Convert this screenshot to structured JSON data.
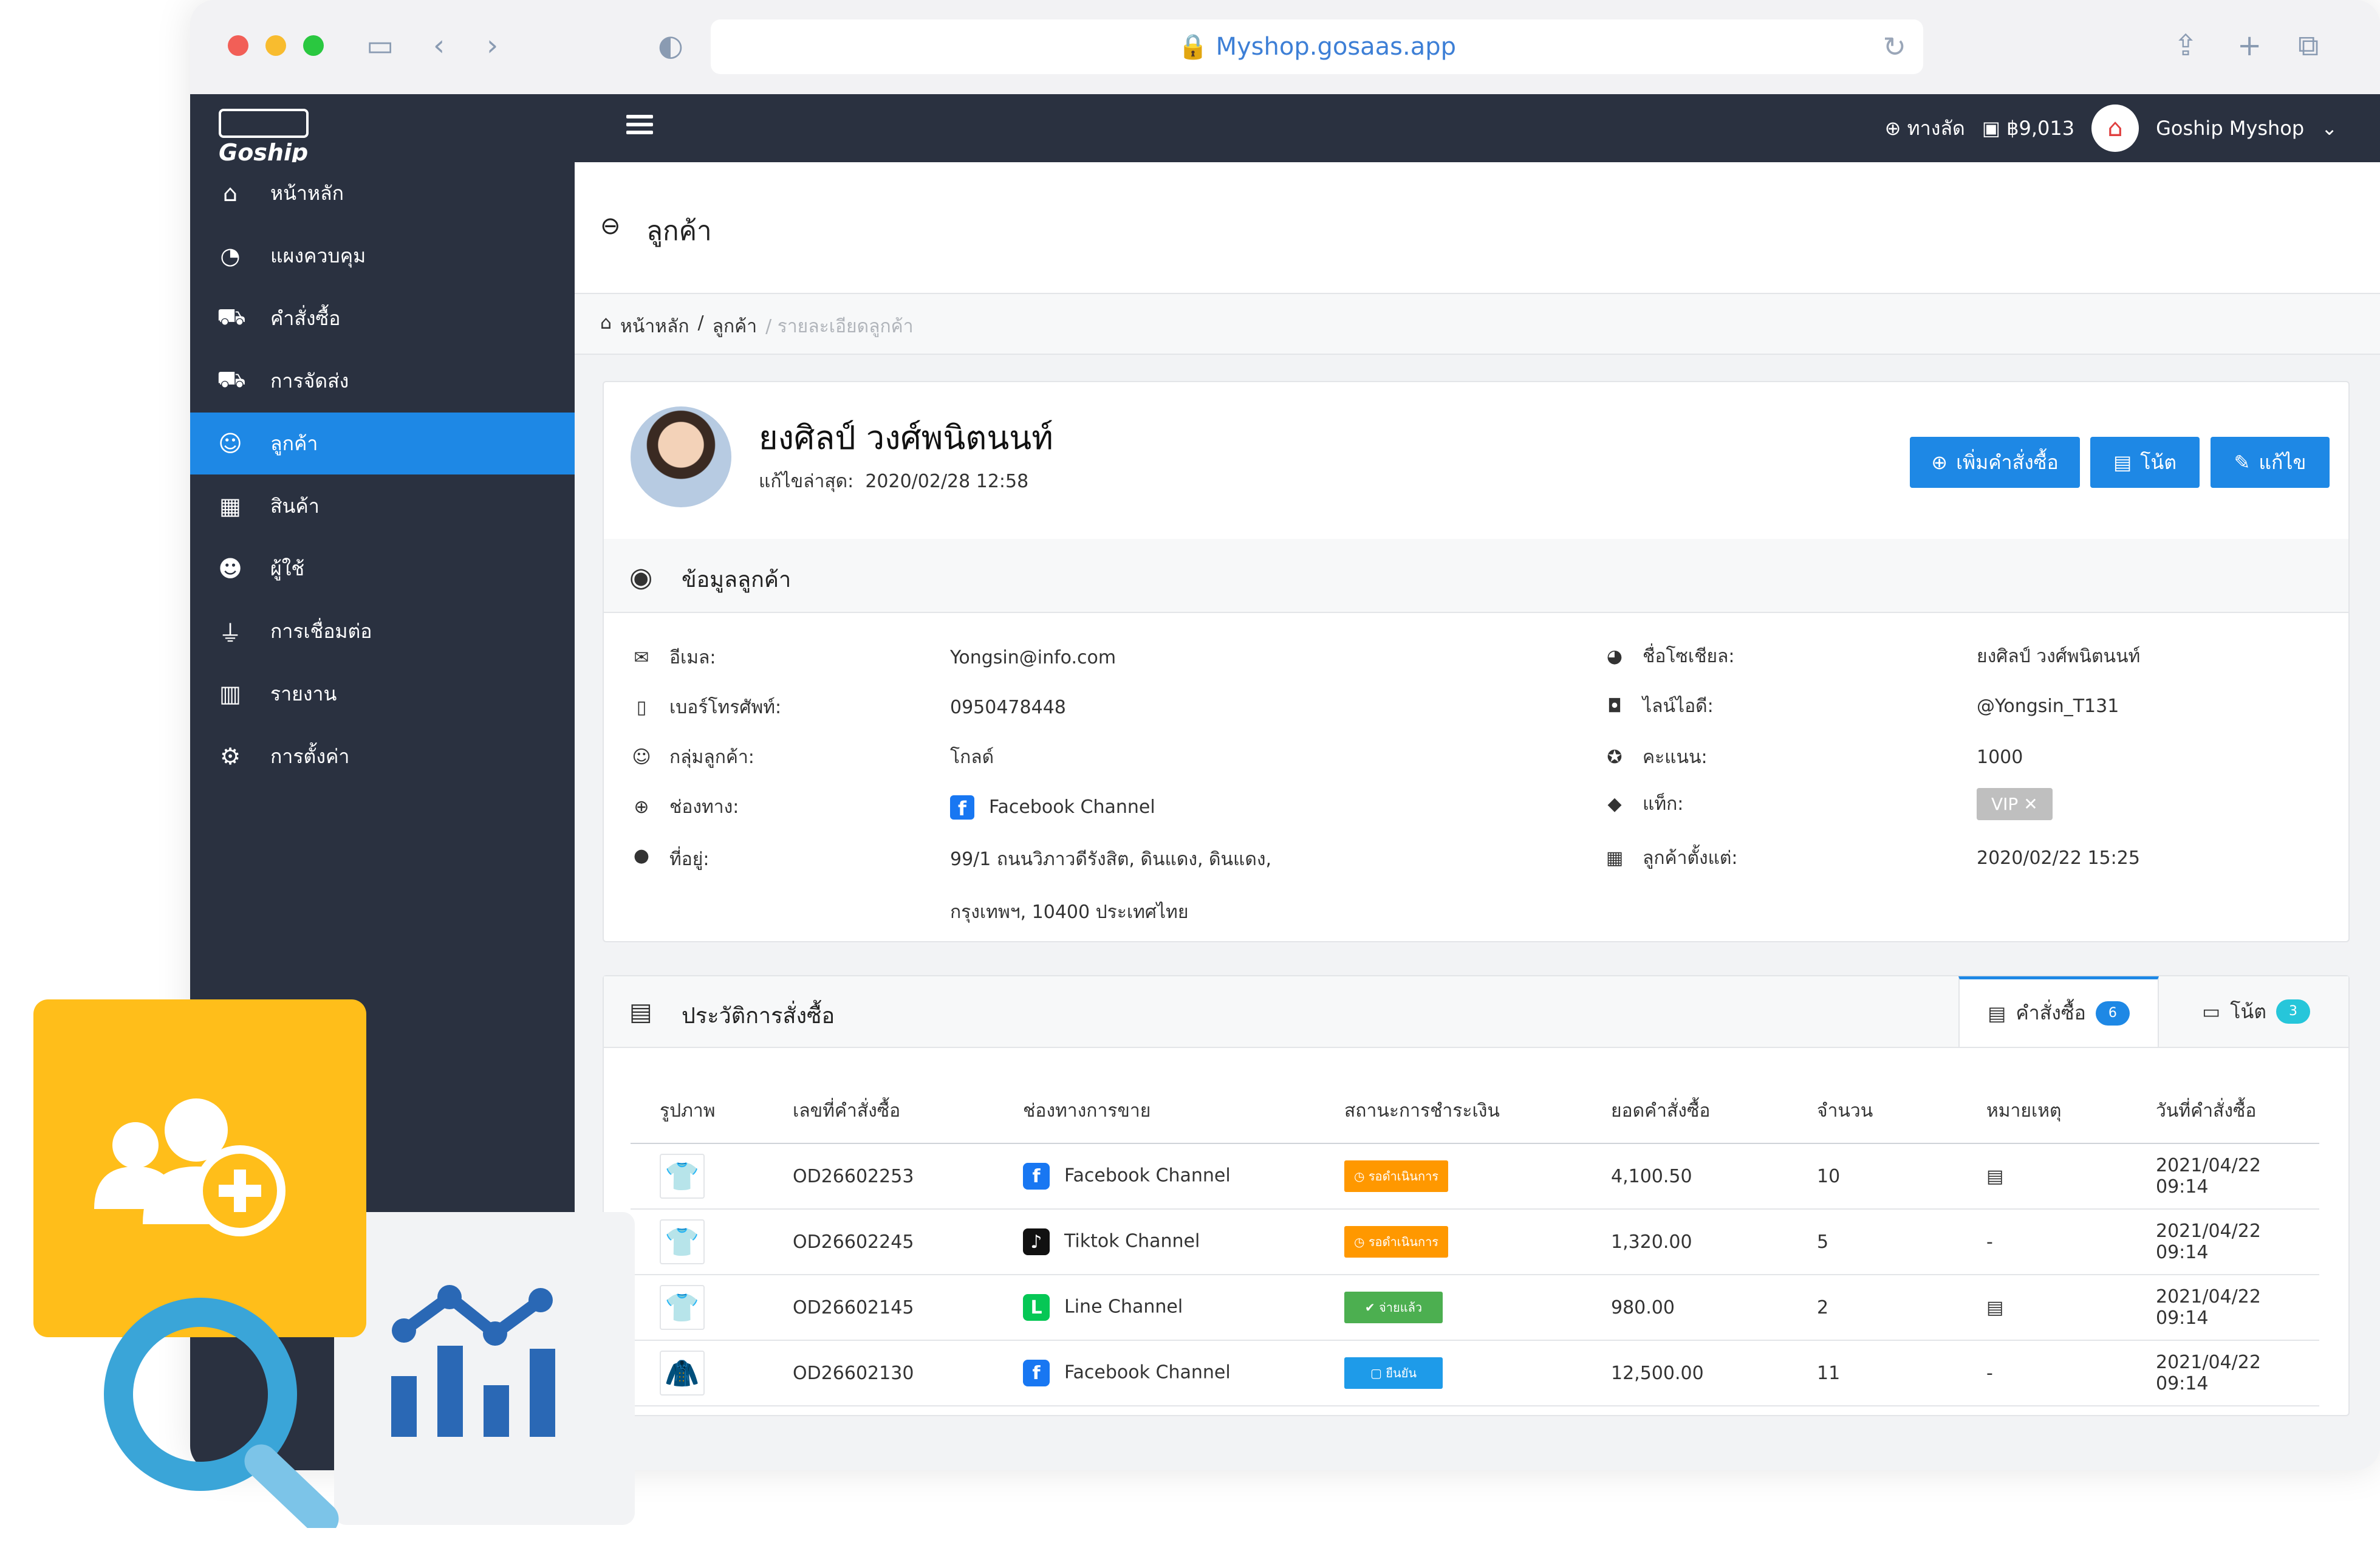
{
  "browser": {
    "url": "Myshop.gosaas.app",
    "traffic_lights": {
      "close": "#f25f57",
      "minimize": "#f8bc2f",
      "maximize": "#2ac840"
    }
  },
  "topbar": {
    "logo_text": "Goship",
    "shortcut_label": "ทางลัด",
    "balance": "฿9,013",
    "shop_name": "Goship Myshop"
  },
  "sidebar": {
    "items": [
      {
        "label": "หน้าหลัก",
        "icon": "home-icon"
      },
      {
        "label": "แผงควบคุม",
        "icon": "dashboard-icon"
      },
      {
        "label": "คำสั่งซื้อ",
        "icon": "cart-icon"
      },
      {
        "label": "การจัดส่ง",
        "icon": "truck-icon"
      },
      {
        "label": "ลูกค้า",
        "icon": "users-icon"
      },
      {
        "label": "สินค้า",
        "icon": "box-icon"
      },
      {
        "label": "ผู้ใช้",
        "icon": "user-cog-icon"
      },
      {
        "label": "การเชื่อมต่อ",
        "icon": "plug-icon"
      },
      {
        "label": "รายงาน",
        "icon": "chart-icon"
      },
      {
        "label": "การตั้งค่า",
        "icon": "gear-icon"
      }
    ],
    "active_index": 4
  },
  "page": {
    "title": "ลูกค้า",
    "breadcrumb": {
      "home": "หน้าหลัก",
      "sep": "/",
      "customers": "ลูกค้า",
      "current": "/ รายละเอียดลูกค้า"
    }
  },
  "profile": {
    "name": "ยงศิลป์ วงศ์พนิตนนท์",
    "last_edited_label": "แก้ไขล่าสุด:",
    "last_edited_value": "2020/02/28 12:58",
    "buttons": {
      "add_order": "เพิ่มคำสั่งซื้อ",
      "note": "โน้ต",
      "edit": "แก้ไข"
    }
  },
  "info": {
    "section_title": "ข้อมูลลูกค้า",
    "left": [
      {
        "label": "อีเมล:",
        "value": "Yongsin@info.com"
      },
      {
        "label": "เบอร์โทรศัพท์:",
        "value": "0950478448"
      },
      {
        "label": "กลุ่มลูกค้า:",
        "value": "โกลด์"
      },
      {
        "label": "ช่องทาง:",
        "value": "Facebook Channel"
      },
      {
        "label": "ที่อยู่:",
        "value": "99/1 ถนนวิภาวดีรังสิต, ดินแดง, ดินแดง,",
        "value2": "กรุงเทพฯ, 10400 ประเทศไทย"
      }
    ],
    "right": [
      {
        "label": "ชื่อโซเชียล:",
        "value": "ยงศิลป์ วงศ์พนิตนนท์"
      },
      {
        "label": "ไลน์ไอดี:",
        "value": "@Yongsin_T131"
      },
      {
        "label": "คะแนน:",
        "value": "1000"
      },
      {
        "label": "แท็ก:",
        "value": "VIP"
      },
      {
        "label": "ลูกค้าตั้งแต่:",
        "value": "2020/02/22 15:25"
      }
    ]
  },
  "history": {
    "title": "ประวัติการสั่งซื้อ",
    "tabs": [
      {
        "label": "คำสั่งซื้อ",
        "count": "6",
        "badge_color": "#1e88e5"
      },
      {
        "label": "โน้ต",
        "count": "3",
        "badge_color": "#26c6da"
      }
    ],
    "columns": [
      "รูปภาพ",
      "เลขที่คำสั่งซื้อ",
      "ช่องทางการขาย",
      "สถานะการชำระเงิน",
      "ยอดคำสั่งซื้อ",
      "จำนวน",
      "หมายเหตุ",
      "วันที่คำสั่งซื้อ"
    ],
    "rows": [
      {
        "image": "shirt",
        "image_color": "#c9a0c7",
        "order_no": "OD26602253",
        "channel": "Facebook Channel",
        "channel_icon": "f",
        "channel_color": "#1877f2",
        "status": "รอดำเนินการ",
        "status_color": "#ff9800",
        "amount": "4,100.50",
        "qty": "10",
        "note": "comment-icon",
        "date": "2021/04/22 09:14"
      },
      {
        "image": "shirt",
        "image_color": "#111111",
        "order_no": "OD26602245",
        "channel": "Tiktok Channel",
        "channel_icon": "♪",
        "channel_color": "#111111",
        "status": "รอดำเนินการ",
        "status_color": "#ff9800",
        "amount": "1,320.00",
        "qty": "5",
        "note": "-",
        "date": "2021/04/22 09:14"
      },
      {
        "image": "shirt",
        "image_color": "#c9a0c7",
        "order_no": "OD26602145",
        "channel": "Line Channel",
        "channel_icon": "L",
        "channel_color": "#06c755",
        "status": "จ่ายแล้ว",
        "status_color": "#4caf50",
        "amount": "980.00",
        "qty": "2",
        "note": "comment-icon",
        "date": "2021/04/22 09:14"
      },
      {
        "image": "jacket",
        "image_color": "#111111",
        "order_no": "OD26602130",
        "channel": "Facebook Channel",
        "channel_icon": "f",
        "channel_color": "#1877f2",
        "status": "ยืนยัน",
        "status_color": "#1e9be9",
        "amount": "12,500.00",
        "qty": "11",
        "note": "-",
        "date": "2021/04/22 09:14"
      }
    ]
  },
  "decorations": {
    "add_user_icon": "add-user-icon",
    "search_icon": "magnifier-icon",
    "chart_icon": "bar-line-chart-icon"
  }
}
